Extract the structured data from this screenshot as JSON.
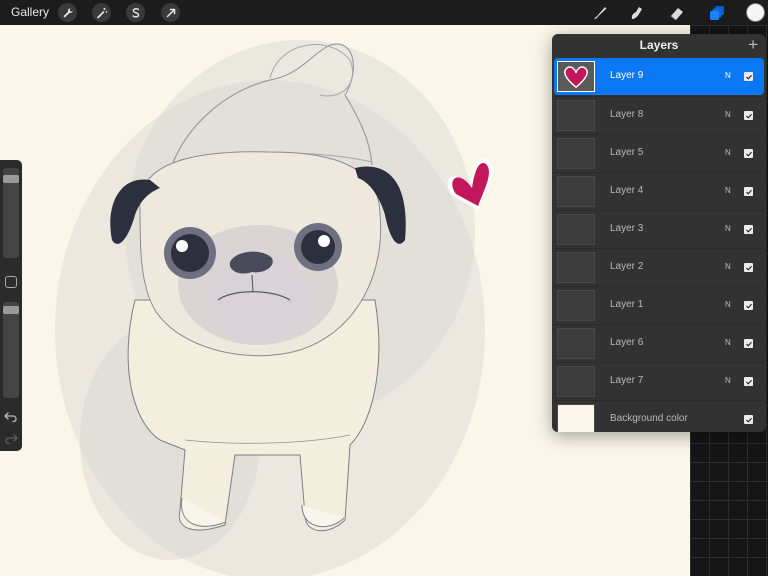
{
  "toolbar": {
    "gallery_label": "Gallery",
    "left_icons": [
      "wrench-icon",
      "magic-wand-icon",
      "selection-icon",
      "transform-arrow-icon"
    ],
    "right_tools": [
      "brush-icon",
      "smudge-icon",
      "eraser-icon",
      "layers-icon"
    ],
    "active_tool": "layers-icon",
    "current_color": "#f5f5f5"
  },
  "layers_panel": {
    "title": "Layers",
    "add_label": "+",
    "layers": [
      {
        "name": "Layer 9",
        "blend": "N",
        "visible": true,
        "active": true
      },
      {
        "name": "Layer 8",
        "blend": "N",
        "visible": true,
        "active": false
      },
      {
        "name": "Layer 5",
        "blend": "N",
        "visible": true,
        "active": false
      },
      {
        "name": "Layer 4",
        "blend": "N",
        "visible": true,
        "active": false
      },
      {
        "name": "Layer 3",
        "blend": "N",
        "visible": true,
        "active": false
      },
      {
        "name": "Layer 2",
        "blend": "N",
        "visible": true,
        "active": false
      },
      {
        "name": "Layer 1",
        "blend": "N",
        "visible": true,
        "active": false
      },
      {
        "name": "Layer 6",
        "blend": "N",
        "visible": true,
        "active": false
      },
      {
        "name": "Layer 7",
        "blend": "N",
        "visible": true,
        "active": false
      }
    ],
    "background": {
      "name": "Background color",
      "visible": true
    }
  },
  "sidebar": {
    "brush_size": 0.92,
    "opacity": 0.95
  },
  "colors": {
    "accent": "#0a78f5",
    "canvas": "#faf6e9",
    "heart": "#c2185b"
  }
}
